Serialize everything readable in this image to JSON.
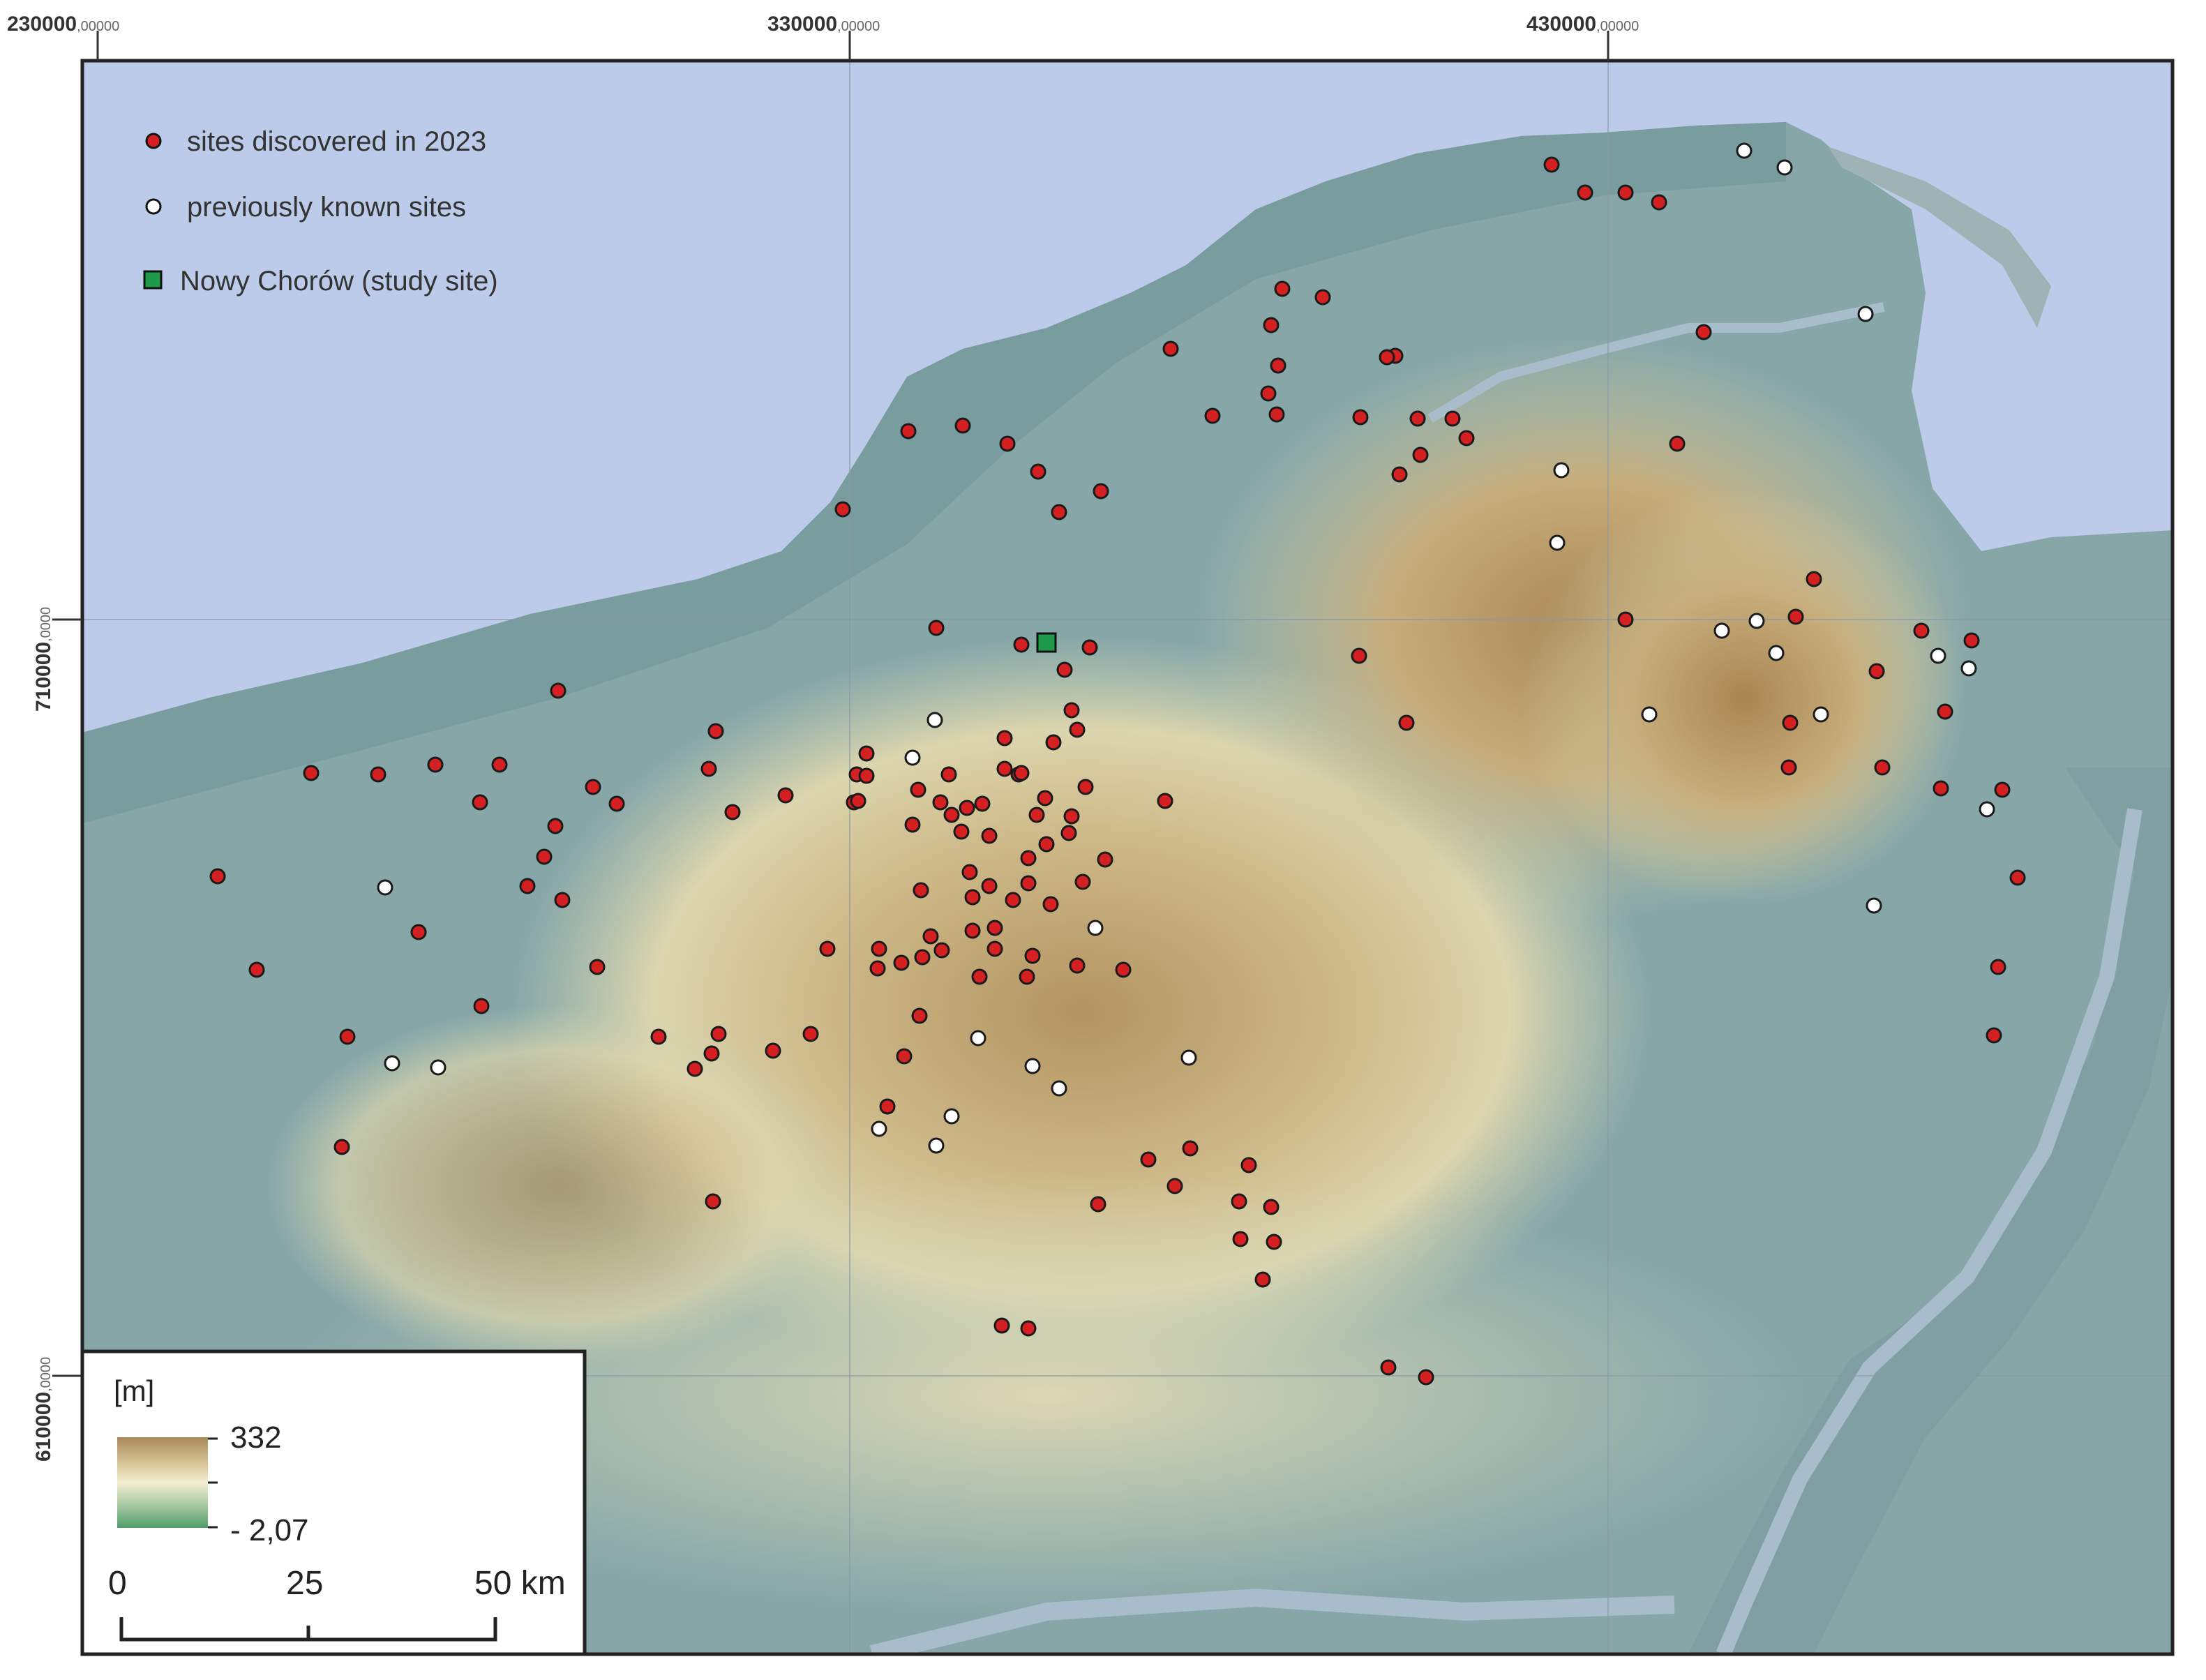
{
  "coordinates": {
    "top": [
      {
        "main": "230000",
        "decimal": ",00000"
      },
      {
        "main": "330000",
        "decimal": ",00000"
      },
      {
        "main": "430000",
        "decimal": ",00000"
      }
    ],
    "left": [
      {
        "main": "710000",
        "decimal": ",0000"
      },
      {
        "main": "610000",
        "decimal": ",0000"
      }
    ]
  },
  "legend": {
    "items": [
      {
        "label": "sites discovered in 2023",
        "symbol": "red-dot",
        "color": "#d42020"
      },
      {
        "label": "previously known sites",
        "symbol": "white-dot",
        "color": "#ffffff"
      },
      {
        "label": "Nowy Chorów (study site)",
        "symbol": "green-square",
        "color": "#1f9a4a"
      }
    ]
  },
  "elevation": {
    "unit": "[m]",
    "max": "332",
    "min": "- 2,07"
  },
  "scalebar": {
    "ticks": [
      "0",
      "25",
      "50 km"
    ]
  },
  "colors": {
    "sea": "#bccbe9",
    "lowland": "#7fa0a4",
    "upland": "#c9b37f",
    "highland": "#a88a5a",
    "frame": "#222222"
  }
}
